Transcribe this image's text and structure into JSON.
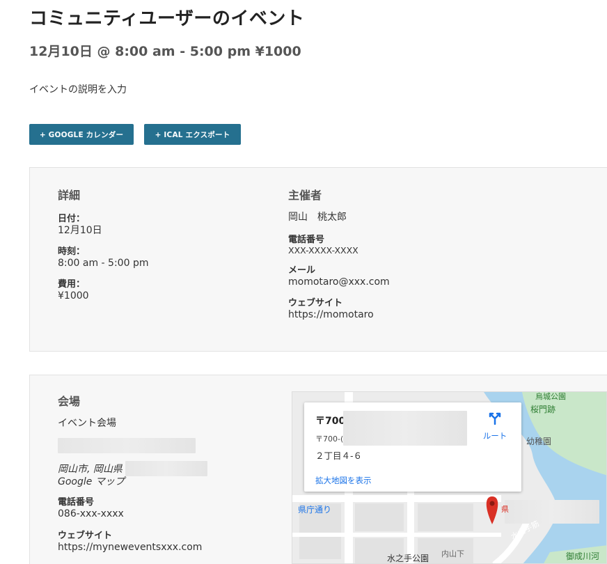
{
  "event": {
    "title": "コミュニティユーザーのイベント",
    "datetime": "12月10日 @ 8:00 am - 5:00 pm ¥1000",
    "description": "イベントの説明を入力"
  },
  "buttons": {
    "google": "+ GOOGLE カレンダー",
    "ical": "+ ICAL エクスポート"
  },
  "details": {
    "heading": "詳細",
    "date_label": "日付：",
    "date_value": "12月10日",
    "time_label": "時刻：",
    "time_value": "8:00 am - 5:00 pm",
    "cost_label": "費用：",
    "cost_value": "¥1000"
  },
  "organizer": {
    "heading": "主催者",
    "name": "岡山　桃太郎",
    "phone_label": "電話番号",
    "phone_value": "XXX-XXXX-XXXX",
    "email_label": "メール",
    "email_value": "momotaro@xxx.com",
    "website_label": "ウェブサイト",
    "website_value": "https://momotaro"
  },
  "venue": {
    "heading": "会場",
    "name": "イベント会場",
    "city": "岡山市, 岡山県",
    "map_link": "Google マップ",
    "phone_label": "電話番号",
    "phone_value": "086-xxx-xxxx",
    "website_label": "ウェブサイト",
    "website_value": "https://myneweventsxxx.com"
  },
  "map": {
    "zip": "〒700",
    "zip2": "〒700-(",
    "address": "２丁目４-６",
    "larger_map": "拡大地図を表示",
    "route": "ルート",
    "labels": {
      "castle_park": "烏城公園",
      "gate": "桜門跡",
      "kindergarten": "幼稚園",
      "prefecture_street": "県庁通り",
      "mizuteai": "水之手公園",
      "uchisange": "内山下",
      "mizunote": "水之手筋",
      "onari": "御成川河",
      "kencho": "県",
      "pin_label": "〒"
    },
    "colors": {
      "water": "#a9d3ee",
      "park": "#c9e7c9",
      "road": "#ffffff",
      "pin": "#d93025"
    }
  }
}
